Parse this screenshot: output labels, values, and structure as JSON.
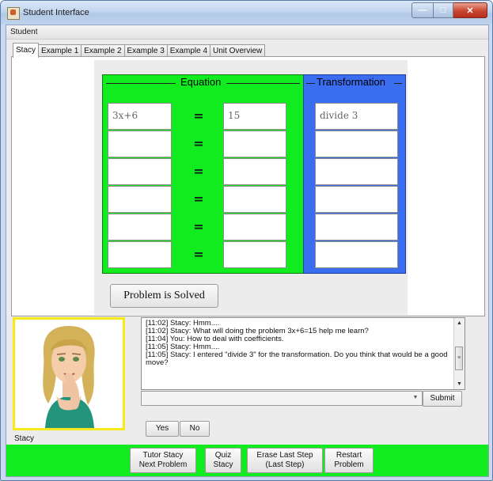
{
  "window": {
    "title": "Student Interface"
  },
  "menu": {
    "items": [
      "Student"
    ]
  },
  "tabs": [
    {
      "label": "Stacy",
      "active": true
    },
    {
      "label": "Example 1",
      "active": false
    },
    {
      "label": "Example 2",
      "active": false
    },
    {
      "label": "Example 3",
      "active": false
    },
    {
      "label": "Example 4",
      "active": false
    },
    {
      "label": "Unit Overview",
      "active": false
    }
  ],
  "worksheet": {
    "equation_title": "Equation",
    "transformation_title": "Transformation",
    "equals_symbol": "=",
    "rows": [
      {
        "left": "3x+6",
        "right": "15",
        "transformation": "divide 3"
      },
      {
        "left": "",
        "right": "",
        "transformation": ""
      },
      {
        "left": "",
        "right": "",
        "transformation": ""
      },
      {
        "left": "",
        "right": "",
        "transformation": ""
      },
      {
        "left": "",
        "right": "",
        "transformation": ""
      },
      {
        "left": "",
        "right": "",
        "transformation": ""
      }
    ],
    "solved_button": "Problem is Solved",
    "colors": {
      "equation_panel": "#10ec1e",
      "transformation_panel": "#3b6df0"
    }
  },
  "agent": {
    "name": "Stacy",
    "border_color": "#f6ea19"
  },
  "chat": {
    "messages": [
      "[11:02] Stacy: Hmm....",
      "[11:02] Stacy: What will doing the problem 3x+6=15 help me learn?",
      "[11:04] You: How to deal with coefficients.",
      "[11:05] Stacy: Hmm....",
      "[11:05] Stacy: I entered \"divide 3\" for the transformation. Do you think that would be a good move?"
    ],
    "input_value": "",
    "submit_label": "Submit",
    "yes_label": "Yes",
    "no_label": "No"
  },
  "commands": {
    "tutor": {
      "line1": "Tutor Stacy",
      "line2": "Next Problem"
    },
    "quiz": {
      "line1": "Quiz",
      "line2": "Stacy"
    },
    "erase": {
      "line1": "Erase Last Step",
      "line2": "(Last Step)"
    },
    "restart": {
      "line1": "Restart",
      "line2": "Problem"
    },
    "bar_color": "#10ec1e"
  }
}
